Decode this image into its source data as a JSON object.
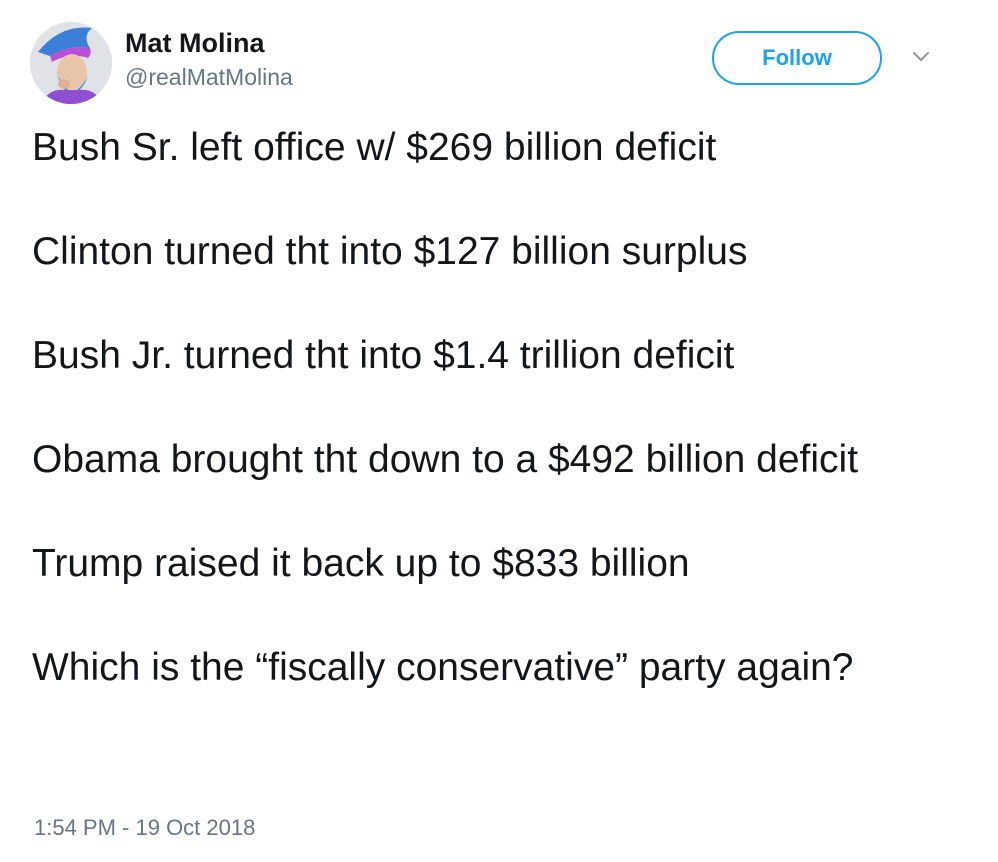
{
  "author": {
    "display_name": "Mat Molina",
    "handle": "@realMatMolina"
  },
  "actions": {
    "follow_label": "Follow"
  },
  "tweet": {
    "paragraphs": [
      "Bush Sr. left office w/ $269 billion deficit",
      "Clinton turned tht into $127 billion surplus",
      "Bush Jr. turned tht into $1.4 trillion deficit",
      "Obama brought tht down to a $492 billion deficit",
      "Trump raised it back up to $833 billion",
      "Which is the “fiscally conservative” party again?"
    ],
    "timestamp": "1:54 PM - 19 Oct 2018"
  },
  "icons": {
    "menu": "chevron-down-icon",
    "avatar": "avatar"
  },
  "colors": {
    "accent": "#1da1f2",
    "text": "#14171a",
    "secondary": "#657786"
  }
}
